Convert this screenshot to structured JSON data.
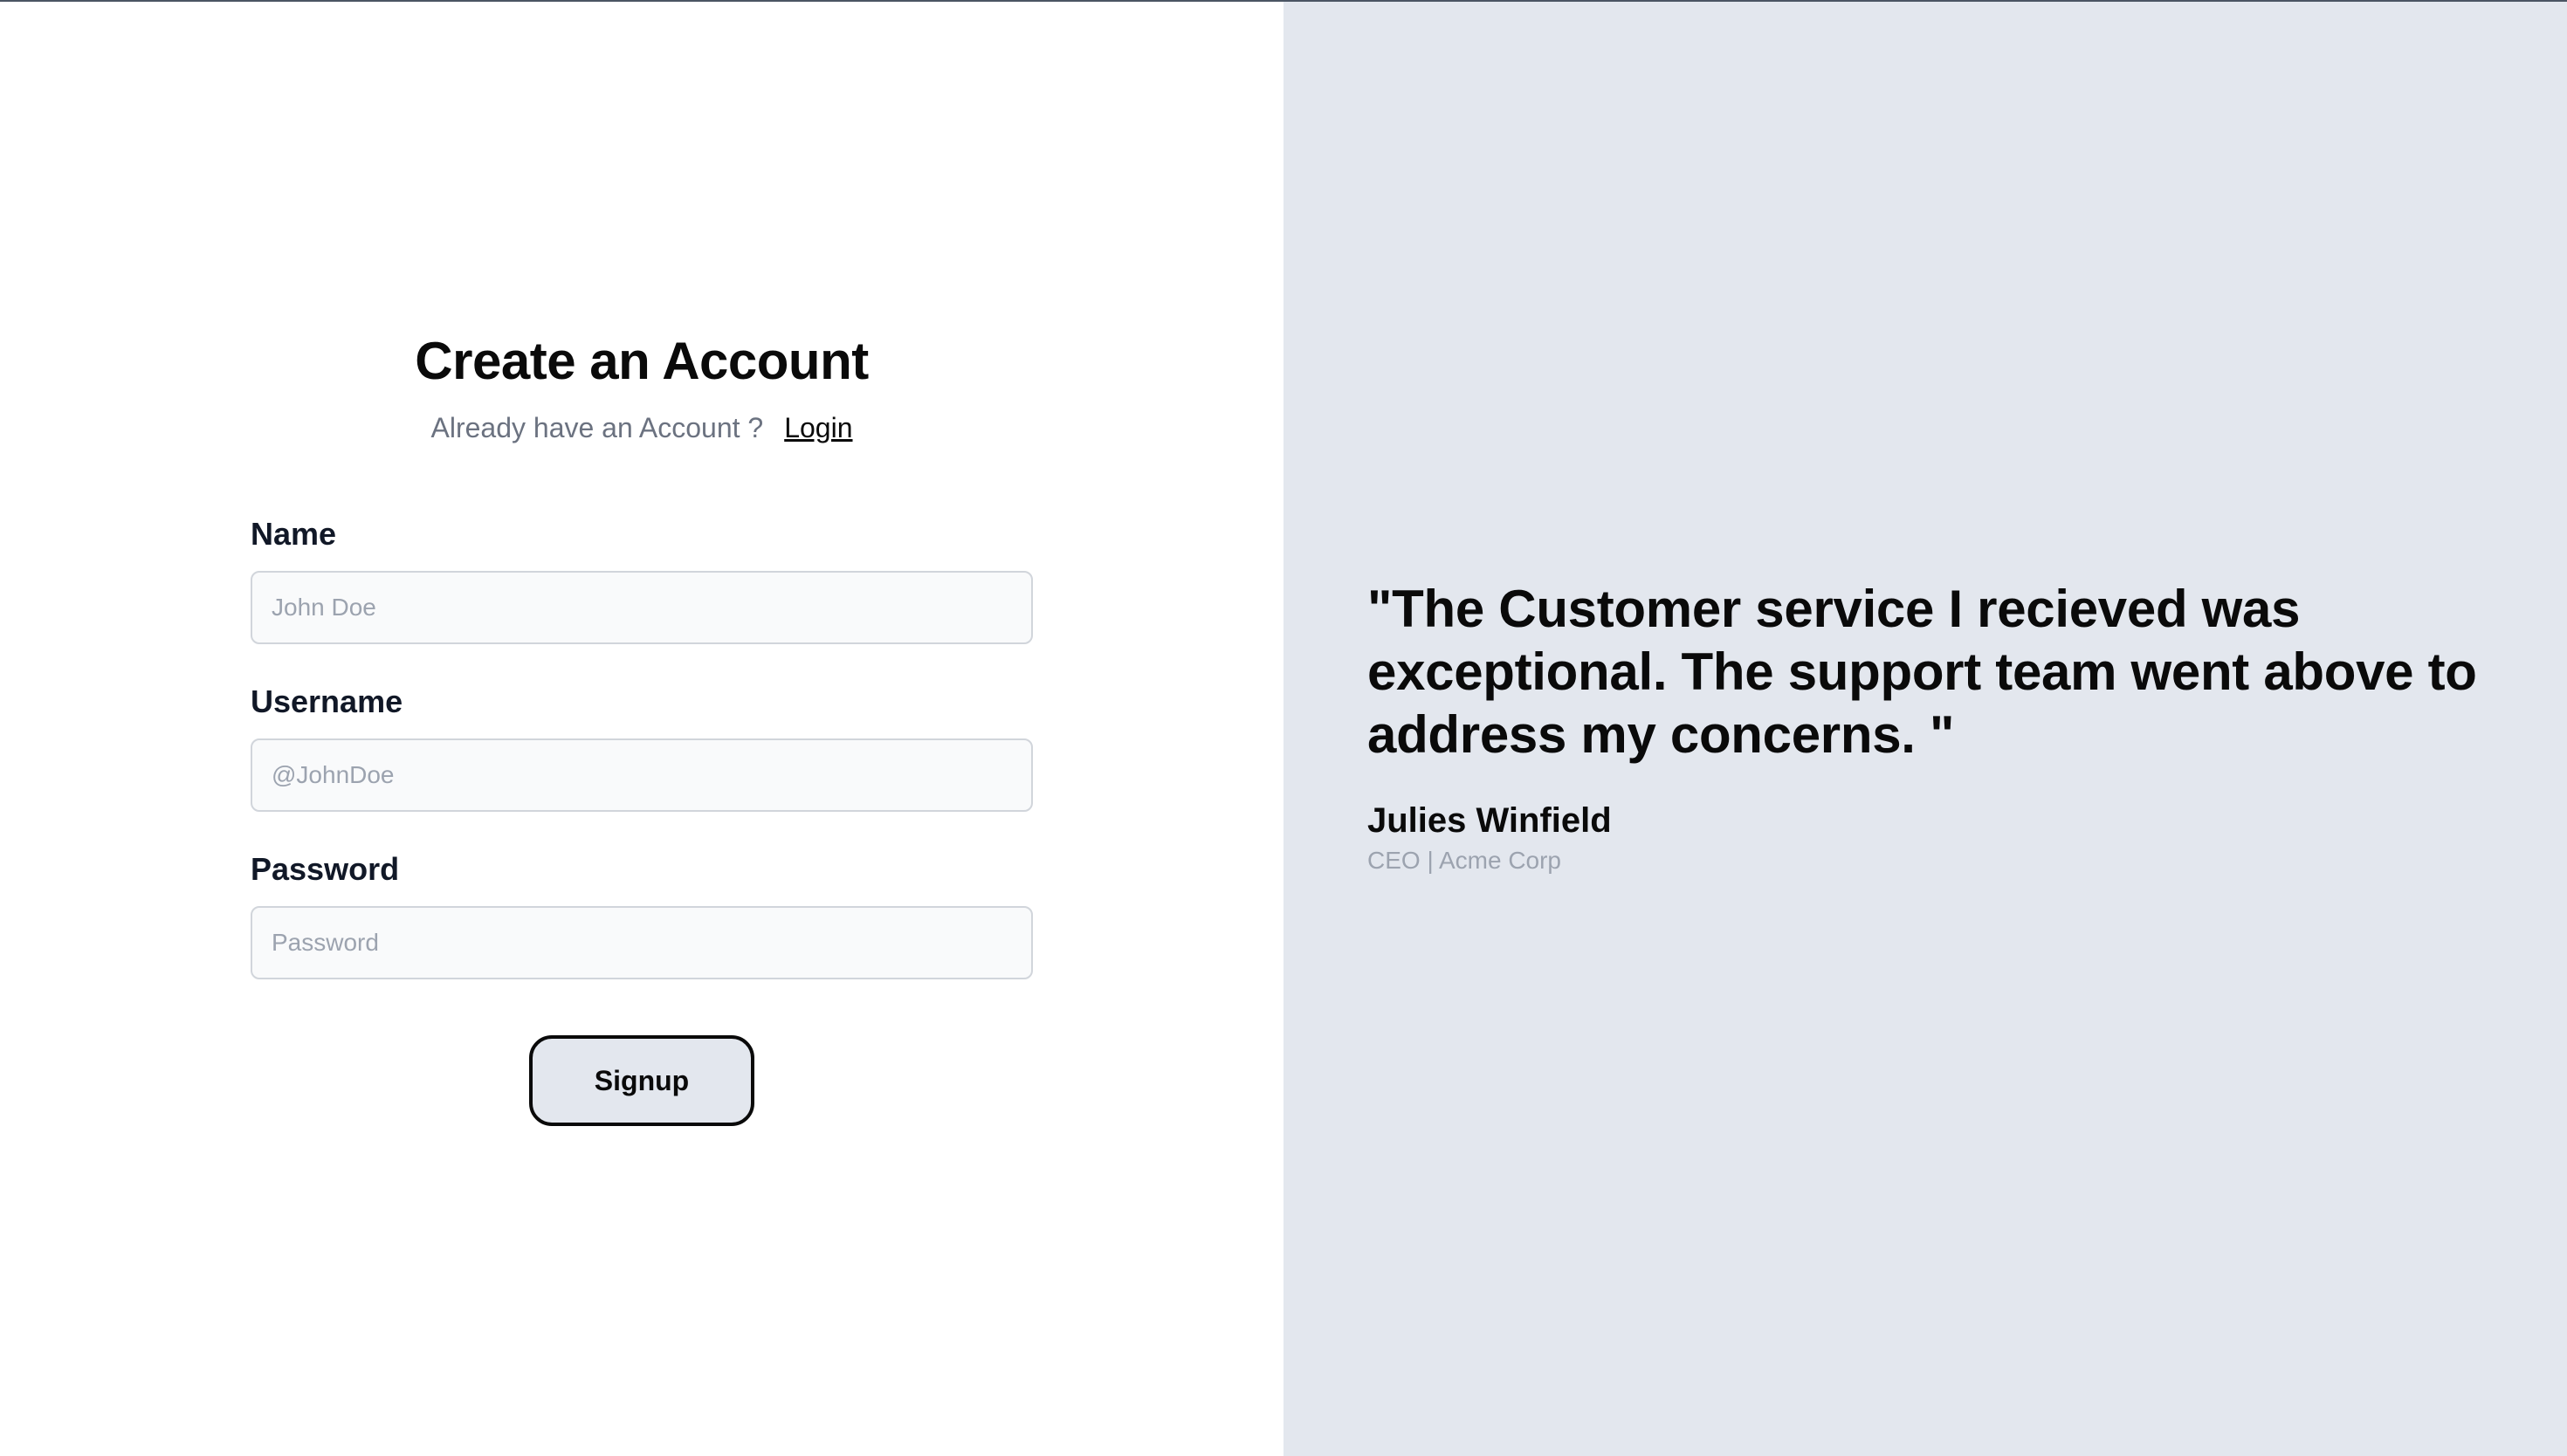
{
  "signup": {
    "title": "Create an Account",
    "subtitle": "Already have an Account ?",
    "login_link": "Login",
    "fields": [
      {
        "label": "Name",
        "placeholder": "John Doe",
        "value": ""
      },
      {
        "label": "Username",
        "placeholder": "@JohnDoe",
        "value": ""
      },
      {
        "label": "Password",
        "placeholder": "Password",
        "value": ""
      }
    ],
    "submit_label": "Signup"
  },
  "testimonial": {
    "quote": "\"The Customer service I recieved was exceptional. The support team went above to address my concerns. \"",
    "author": "Julies Winfield",
    "role": "CEO | Acme Corp"
  },
  "colors": {
    "right_panel_bg": "#e3e7ee",
    "button_bg": "#e3e7ee",
    "button_border": "#0a0a0a",
    "muted_text": "#6b7280",
    "placeholder_text": "#9ca3af"
  }
}
